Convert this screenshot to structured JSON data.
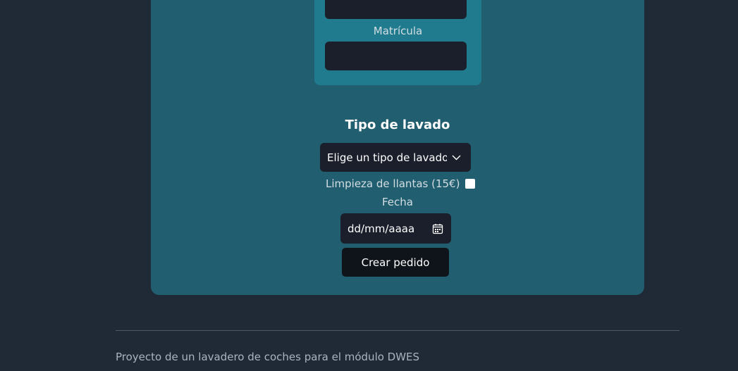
{
  "form": {
    "matricula_label": "Matrícula",
    "tipo_lavado_title": "Tipo de lavado",
    "tipo_lavado_select": {
      "selected": "Elige un tipo de lavado..."
    },
    "limpieza_llantas_label": "Limpieza de llantas (15€)",
    "limpieza_llantas_checked": false,
    "fecha_label": "Fecha",
    "fecha_placeholder": "dd/mm/aaaa",
    "submit_label": "Crear pedido"
  },
  "footer": {
    "text": "Proyecto de un lavadero de coches para el módulo DWES"
  },
  "colors": {
    "background": "#202a37",
    "card": "#215f70",
    "inner_panel": "#207b8e",
    "input": "#1a1f2b",
    "button": "#0f141b"
  },
  "icons": {
    "select_arrow": "chevron-down-icon",
    "date_picker": "calendar-icon"
  }
}
